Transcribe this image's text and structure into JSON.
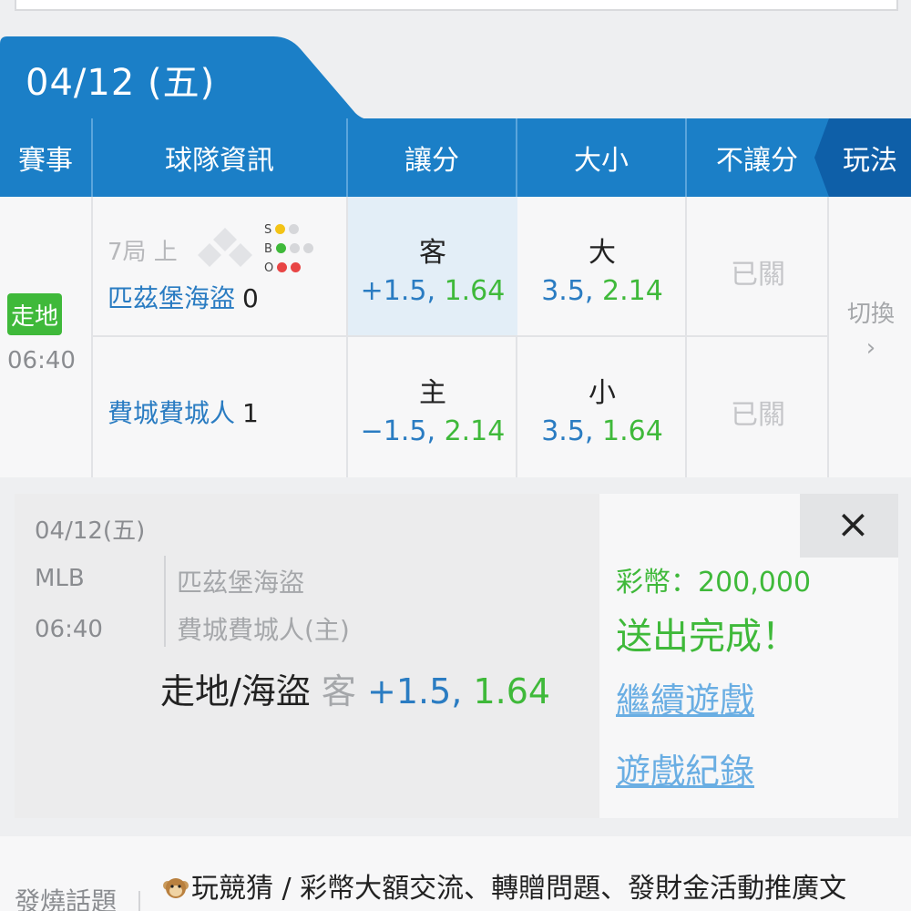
{
  "date_tab": {
    "label": "04/12 (五)"
  },
  "header": {
    "col_event": "賽事",
    "col_team": "球隊資訊",
    "col_spread": "讓分",
    "col_total": "大小",
    "col_moneyline": "不讓分",
    "col_play": "玩法"
  },
  "match": {
    "status_badge": "走地",
    "time": "06:40",
    "inning": "7局 上",
    "sbo": {
      "s": "S",
      "b": "B",
      "o": "O"
    },
    "away": {
      "name": "匹茲堡海盜",
      "score": "0"
    },
    "home": {
      "name": "費城費城人",
      "score": "1"
    },
    "spread": {
      "away": {
        "side": "客",
        "line": "+1.5,",
        "odds": "1.64"
      },
      "home": {
        "side": "主",
        "line": "−1.5,",
        "odds": "2.14"
      }
    },
    "total": {
      "over": {
        "side": "大",
        "line": "3.5,",
        "odds": "2.14"
      },
      "under": {
        "side": "小",
        "line": "3.5,",
        "odds": "1.64"
      }
    },
    "moneyline": {
      "away": "已關",
      "home": "已關"
    },
    "switch_label": "切換",
    "switch_chevron": "›"
  },
  "bet_panel": {
    "date": "04/12(五)",
    "league": "MLB",
    "time": "06:40",
    "away_team": "匹茲堡海盜",
    "home_team": "費城費城人(主)",
    "bet_name": "走地/海盜",
    "bet_side": "客",
    "bet_line": "+1.5,",
    "bet_odds": "1.64",
    "coins": "彩幣：200,000",
    "success": "送出完成！",
    "continue_link": "繼續遊戲",
    "history_link": "遊戲紀錄",
    "close": "×"
  },
  "footer": {
    "left_label": "發燒話題",
    "news": "玩競猜 / 彩幣大額交流、轉贈問題、發財金活動推廣文"
  },
  "colors": {
    "header_blue": "#1b7fc7",
    "header_dark": "#0e5fa8",
    "odds_blue": "#2a7cc2",
    "odds_green": "#3fb93a",
    "link": "#6aaee3"
  }
}
